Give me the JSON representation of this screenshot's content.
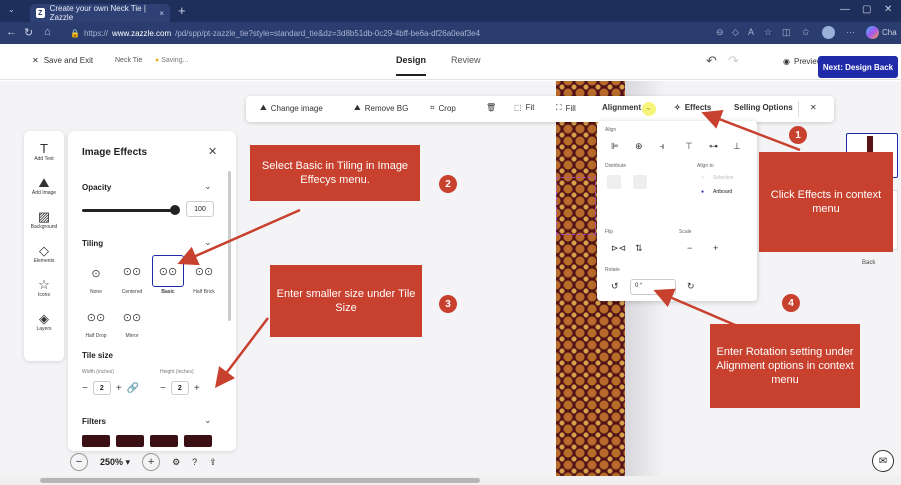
{
  "browser": {
    "tab_title": "Create your own Neck Tie | Zazzle",
    "tab_close": "×",
    "new_tab": "+",
    "url_prefix": "https://",
    "url_host": "www.zazzle.com",
    "url_path": "/pd/spp/pt-zazzle_tie?style=standard_tie&dz=3d8b51db-0c29-4bff-be6a-df26a0eaf3e4",
    "profile_label": "Cha"
  },
  "header": {
    "save_exit": "Save and Exit",
    "product": "Neck Tie",
    "saving": "Saving...",
    "tab_design": "Design",
    "tab_review": "Review",
    "preview": "Preview",
    "next": "Next: Design Back"
  },
  "context_toolbar": {
    "change_image": "Change image",
    "remove_bg": "Remove BG",
    "crop": "Crop",
    "fit": "Fit",
    "fill": "Fill",
    "alignment": "Alignment",
    "effects": "Effects",
    "selling_options": "Selling Options"
  },
  "rail": [
    {
      "label": "Add Text",
      "icon": "T"
    },
    {
      "label": "Add Image",
      "icon": "⛰"
    },
    {
      "label": "Background",
      "icon": "▨"
    },
    {
      "label": "Elements",
      "icon": "◇"
    },
    {
      "label": "Icons",
      "icon": "☆"
    },
    {
      "label": "Layers",
      "icon": "◈"
    }
  ],
  "effects_panel": {
    "title": "Image Effects",
    "opacity_label": "Opacity",
    "opacity_value": "100",
    "tiling_label": "Tiling",
    "tiling_options": [
      "None",
      "Centered",
      "Basic",
      "Half Brick",
      "Half Drop",
      "Mirror"
    ],
    "tiling_selected": "Basic",
    "tile_size_label": "Tile size",
    "width_label": "Width (inches)",
    "height_label": "Height (inches)",
    "width_value": "2",
    "height_value": "2",
    "filters_label": "Filters"
  },
  "alignment_menu": {
    "align": "Align",
    "distribute": "Distribute",
    "align_to": "Align to",
    "selection": "Selection",
    "artboard": "Artboard",
    "flip": "Flip",
    "scale": "Scale",
    "rotate": "Rotate",
    "rotate_value": "0 °"
  },
  "thumbnails": {
    "back_label": "Back"
  },
  "zoom": {
    "level": "250%"
  },
  "annotations": {
    "c1": "Click Effects in context menu",
    "c2": "Select Basic in Tiling  in Image Effecys menu.",
    "c3": "Enter smaller size under Tile Size",
    "c4": "Enter Rotation setting under Alignment options in context menu",
    "n1": "1",
    "n2": "2",
    "n3": "3",
    "n4": "4"
  },
  "colors": {
    "accent": "#1f2ba8",
    "callout": "#c8412f",
    "tie": "#5a1418"
  }
}
